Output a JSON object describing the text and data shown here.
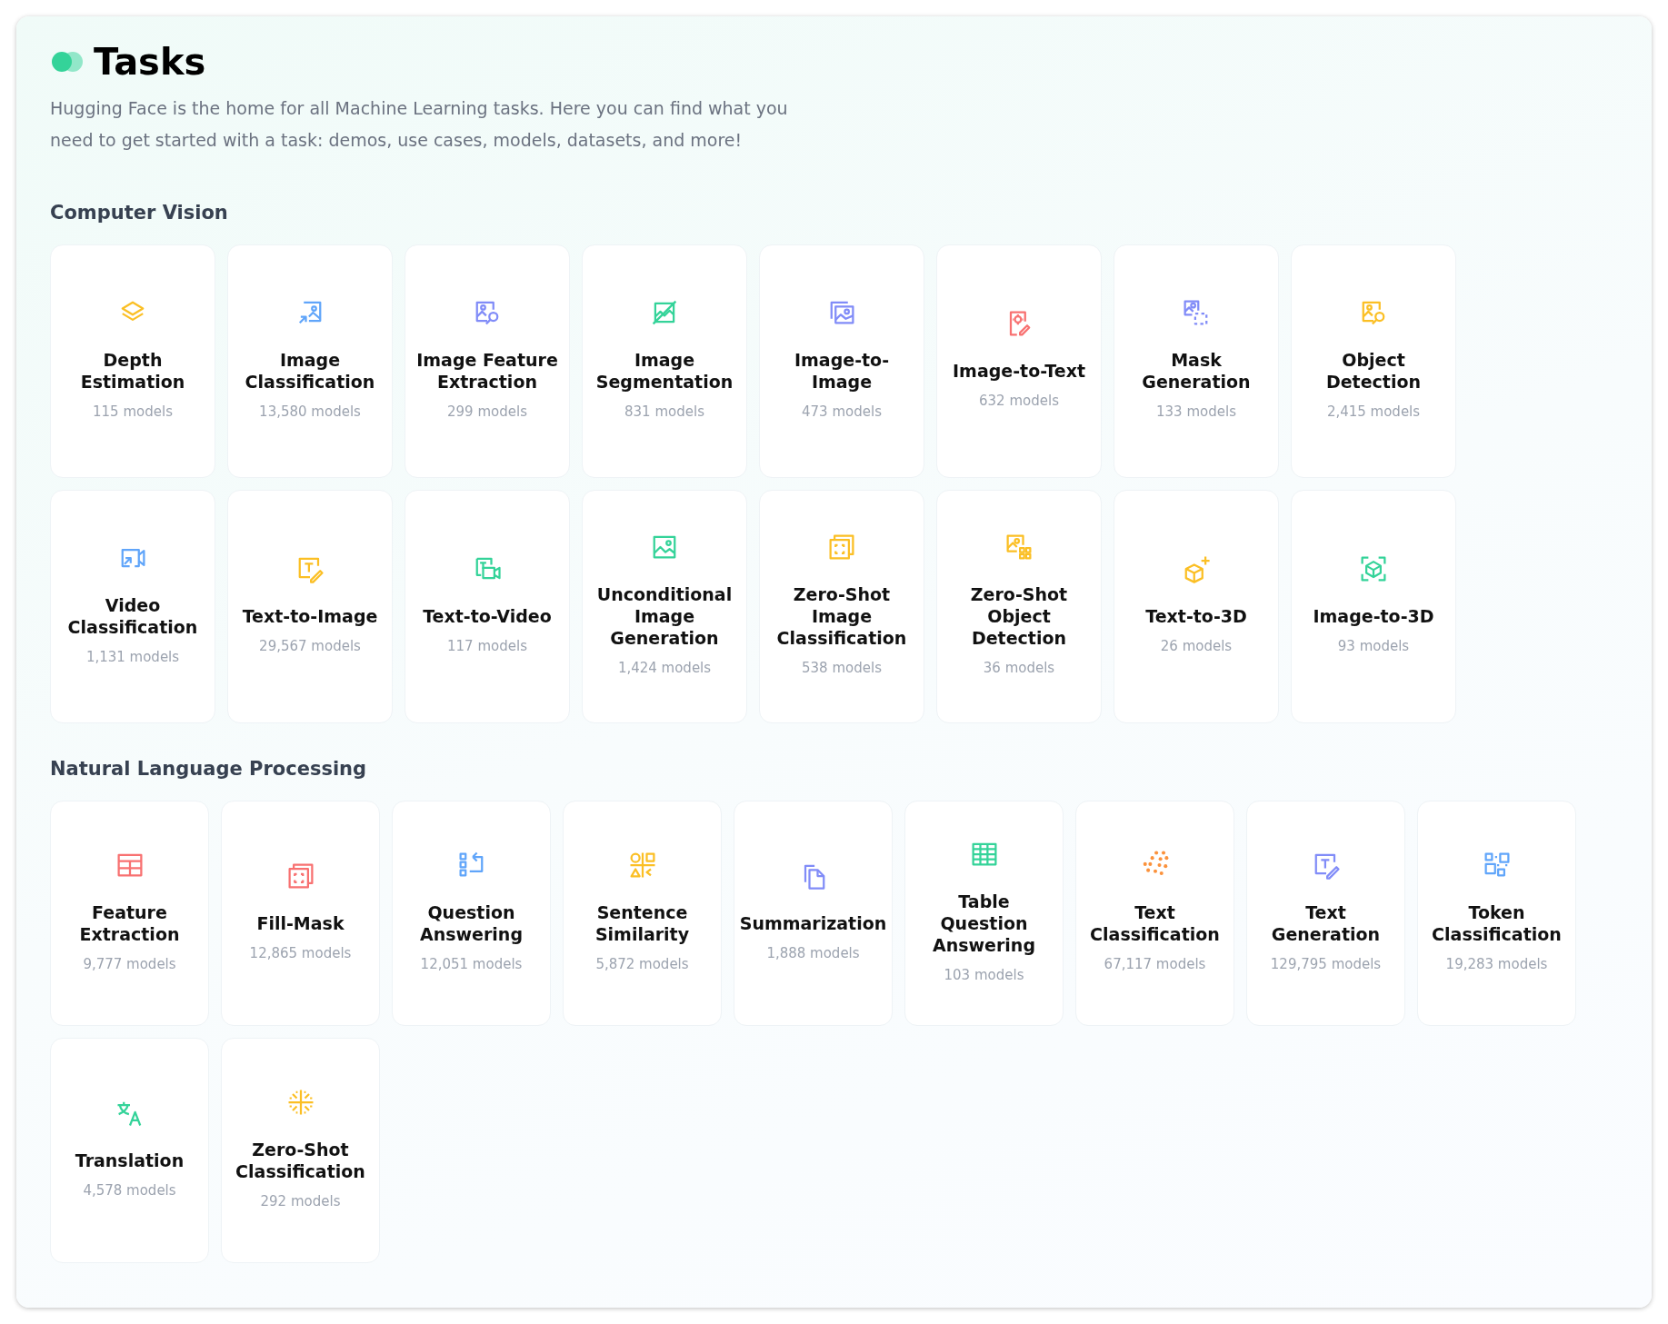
{
  "title": "Tasks",
  "description": "Hugging Face is the home for all Machine Learning tasks. Here you can find what you need to get started with a task: demos, use cases, models, datasets, and more!",
  "sections": [
    {
      "heading": "Computer Vision",
      "tasks": [
        {
          "name": "Depth Estimation",
          "count": "115 models",
          "kind": "layers",
          "color": "#fbbf24"
        },
        {
          "name": "Image Classification",
          "count": "13,580 models",
          "kind": "image-arrow",
          "color": "#60a5fa"
        },
        {
          "name": "Image Feature Extraction",
          "count": "299 models",
          "kind": "image-search",
          "color": "#818cf8"
        },
        {
          "name": "Image Segmentation",
          "count": "831 models",
          "kind": "image-slash",
          "color": "#34d399"
        },
        {
          "name": "Image-to-Image",
          "count": "473 models",
          "kind": "image-stack",
          "color": "#818cf8"
        },
        {
          "name": "Image-to-Text",
          "count": "632 models",
          "kind": "doc-gear",
          "color": "#f87171"
        },
        {
          "name": "Mask Generation",
          "count": "133 models",
          "kind": "image-dashed",
          "color": "#818cf8"
        },
        {
          "name": "Object Detection",
          "count": "2,415 models",
          "kind": "image-search",
          "color": "#fbbf24"
        },
        {
          "name": "Video Classification",
          "count": "1,131 models",
          "kind": "video-arrow",
          "color": "#60a5fa"
        },
        {
          "name": "Text-to-Image",
          "count": "29,567 models",
          "kind": "text-pencil",
          "color": "#fbbf24"
        },
        {
          "name": "Text-to-Video",
          "count": "117 models",
          "kind": "text-video",
          "color": "#34d399"
        },
        {
          "name": "Unconditional Image Generation",
          "count": "1,424 models",
          "kind": "image",
          "color": "#34d399"
        },
        {
          "name": "Zero-Shot Image Classification",
          "count": "538 models",
          "kind": "dashed-square",
          "color": "#fbbf24"
        },
        {
          "name": "Zero-Shot Object Detection",
          "count": "36 models",
          "kind": "image-squares",
          "color": "#fbbf24"
        },
        {
          "name": "Text-to-3D",
          "count": "26 models",
          "kind": "cube-plus",
          "color": "#fbbf24"
        },
        {
          "name": "Image-to-3D",
          "count": "93 models",
          "kind": "cube-frame",
          "color": "#34d399"
        }
      ]
    },
    {
      "heading": "Natural Language Processing",
      "tasks": [
        {
          "name": "Feature Extraction",
          "count": "9,777 models",
          "kind": "table",
          "color": "#f87171"
        },
        {
          "name": "Fill-Mask",
          "count": "12,865 models",
          "kind": "dashed-square",
          "color": "#f87171"
        },
        {
          "name": "Question Answering",
          "count": "12,051 models",
          "kind": "list-return",
          "color": "#60a5fa"
        },
        {
          "name": "Sentence Similarity",
          "count": "5,872 models",
          "kind": "quadrants",
          "color": "#fbbf24"
        },
        {
          "name": "Summarization",
          "count": "1,888 models",
          "kind": "documents",
          "color": "#818cf8"
        },
        {
          "name": "Table Question Answering",
          "count": "103 models",
          "kind": "grid",
          "color": "#34d399"
        },
        {
          "name": "Text Classification",
          "count": "67,117 models",
          "kind": "dots",
          "color": "#fb923c"
        },
        {
          "name": "Text Generation",
          "count": "129,795 models",
          "kind": "text-pencil",
          "color": "#818cf8"
        },
        {
          "name": "Token Classification",
          "count": "19,283 models",
          "kind": "squares",
          "color": "#60a5fa"
        },
        {
          "name": "Translation",
          "count": "4,578 models",
          "kind": "translate",
          "color": "#34d399"
        },
        {
          "name": "Zero-Shot Classification",
          "count": "292 models",
          "kind": "sparkle-grid",
          "color": "#fbbf24"
        }
      ]
    }
  ]
}
